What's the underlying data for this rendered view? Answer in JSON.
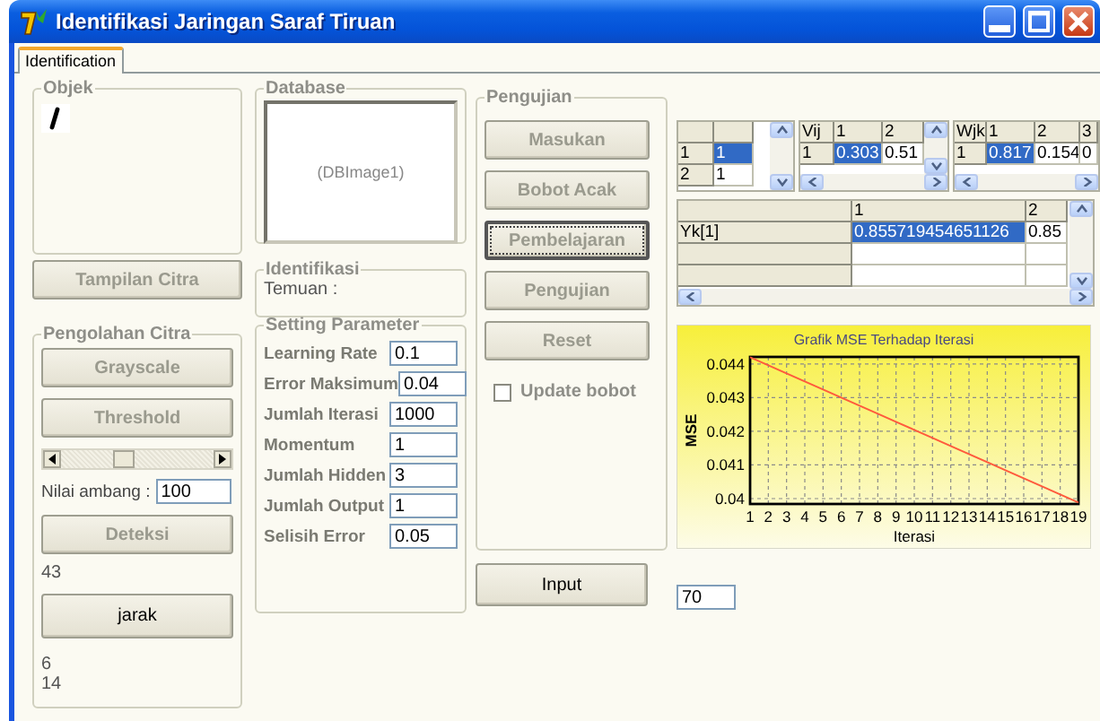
{
  "window": {
    "title": "Identifikasi Jaringan Saraf Tiruan"
  },
  "tabs": [
    {
      "label": "Identification",
      "selected": true
    }
  ],
  "objek": {
    "title": "Objek"
  },
  "tampilan_button": {
    "label": "Tampilan Citra",
    "disabled": true
  },
  "pengolahan": {
    "title": "Pengolahan Citra",
    "buttons": [
      {
        "label": "Grayscale",
        "disabled": true
      },
      {
        "label": "Threshold",
        "disabled": true
      }
    ],
    "slider": {
      "level": 0.39
    },
    "threshold_label": "Nilai ambang :",
    "threshold_value": "100",
    "detect_button": {
      "label": "Deteksi",
      "disabled": true
    },
    "detect_result": "43",
    "distance_button": {
      "label": "jarak",
      "disabled": false
    },
    "results": [
      "6",
      "14"
    ]
  },
  "database": {
    "title": "Database",
    "image_label": "(DBImage1)"
  },
  "identifikasi": {
    "title": "Identifikasi",
    "label": "Temuan :"
  },
  "parameters": {
    "title": "Setting Parameter",
    "rows": [
      {
        "label": "Learning Rate",
        "value": "0.1"
      },
      {
        "label": "Error Maksimum",
        "value": "0.04"
      },
      {
        "label": "Jumlah Iterasi",
        "value": "1000"
      },
      {
        "label": "Momentum",
        "value": "1"
      },
      {
        "label": "Jumlah Hidden",
        "value": "3"
      },
      {
        "label": "Jumlah Output",
        "value": "1"
      },
      {
        "label": "Selisih Error",
        "value": "0.05"
      }
    ]
  },
  "pengujian": {
    "title": "Pengujian",
    "buttons": [
      {
        "label": "Masukan",
        "disabled": true,
        "focused": false
      },
      {
        "label": "Bobot Acak",
        "disabled": true,
        "focused": false
      },
      {
        "label": "Pembelajaran",
        "disabled": true,
        "focused": true
      },
      {
        "label": "Pengujian",
        "disabled": true,
        "focused": false
      },
      {
        "label": "Reset",
        "disabled": true,
        "focused": false
      }
    ],
    "update_checkbox": {
      "label": "Update bobot",
      "checked": false
    }
  },
  "input_button": {
    "label": "Input",
    "disabled": false
  },
  "grids": [
    {
      "columns": [
        "",
        ""
      ],
      "rows": [
        {
          "cells": [
            {
              "text": "1",
              "selected": false
            },
            {
              "text": "1",
              "selected": true
            }
          ]
        },
        {
          "cells": [
            {
              "text": "2",
              "selected": false
            },
            {
              "text": "1",
              "selected": false
            }
          ]
        }
      ],
      "vscroll": true,
      "hscroll": false
    },
    {
      "columns": [
        "Vij",
        "1",
        "2"
      ],
      "rows": [
        {
          "cells": [
            {
              "text": "1",
              "selected": false
            },
            {
              "text": "0.303",
              "selected": true
            },
            {
              "text": "0.51",
              "selected": false
            }
          ]
        }
      ],
      "vscroll": true,
      "hscroll": true
    },
    {
      "columns": [
        "Wjk",
        "1",
        "2",
        "3"
      ],
      "rows": [
        {
          "cells": [
            {
              "text": "1",
              "selected": false
            },
            {
              "text": "0.817",
              "selected": true
            },
            {
              "text": "0.154",
              "selected": false
            },
            {
              "text": "0",
              "selected": false
            }
          ]
        }
      ],
      "vscroll": false,
      "hscroll": true
    },
    {
      "columns": [
        "",
        "1",
        "2"
      ],
      "rows": [
        {
          "cells": [
            {
              "text": "Yk[1]",
              "selected": false
            },
            {
              "text": "0.855719454651126",
              "selected": true
            },
            {
              "text": "0.85",
              "selected": false
            }
          ]
        },
        {
          "cells": [
            {
              "text": "",
              "selected": false
            },
            {
              "text": "",
              "selected": false
            },
            {
              "text": "",
              "selected": false
            }
          ]
        },
        {
          "cells": [
            {
              "text": "",
              "selected": false
            },
            {
              "text": "",
              "selected": false
            },
            {
              "text": "",
              "selected": false
            }
          ]
        }
      ],
      "vscroll": true,
      "hscroll": true
    }
  ],
  "chart_data": {
    "type": "line",
    "title": "Grafik MSE Terhadap Iterasi",
    "xlabel": "Iterasi",
    "ylabel": "MSE",
    "x": [
      1,
      2,
      3,
      4,
      5,
      6,
      7,
      8,
      9,
      10,
      11,
      12,
      13,
      14,
      15,
      16,
      17,
      18,
      19
    ],
    "grid": true,
    "series": [
      {
        "color": "#ff5a3c",
        "values": [
          0.0442,
          0.04396,
          0.04372,
          0.04348,
          0.04324,
          0.043,
          0.04276,
          0.04252,
          0.04228,
          0.04204,
          0.0418,
          0.04156,
          0.04132,
          0.04108,
          0.04084,
          0.0406,
          0.04036,
          0.04012,
          0.03988
        ]
      }
    ],
    "xlim": [
      1,
      19
    ],
    "ylim": [
      0.03984,
      0.04421
    ],
    "xticks": [
      1,
      2,
      3,
      4,
      5,
      6,
      7,
      8,
      9,
      10,
      11,
      12,
      13,
      14,
      15,
      16,
      17,
      18,
      19
    ],
    "yticks": [
      {
        "value": 0.04,
        "label": "0.04"
      },
      {
        "value": 0.041,
        "label": "0.041"
      },
      {
        "value": 0.042,
        "label": "0.042"
      },
      {
        "value": 0.043,
        "label": "0.043"
      },
      {
        "value": 0.044,
        "label": "0.044"
      }
    ]
  },
  "value_field": "70"
}
